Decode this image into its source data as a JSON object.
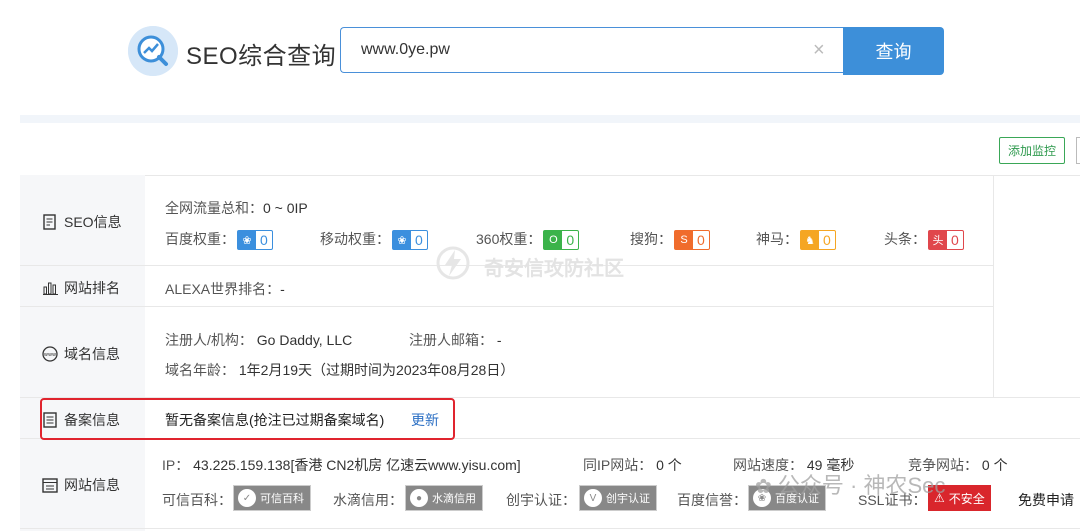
{
  "header": {
    "title": "SEO综合查询",
    "search_value": "www.0ye.pw",
    "clear_glyph": "×",
    "search_button": "查询"
  },
  "toolbar": {
    "monitor_button": "添加监控"
  },
  "watermark": "奇安信攻防社区",
  "wx_overlay": "公众号 · 神农Sec",
  "rows": {
    "seo": {
      "label": "SEO信息",
      "traffic_label": "全网流量总和：",
      "traffic_value": "0 ~ 0IP",
      "weights": [
        {
          "label": "百度权重：",
          "value": "0",
          "color": "#3b8fde",
          "icon": "paw-icon",
          "glyph": "❀"
        },
        {
          "label": "移动权重：",
          "value": "0",
          "color": "#3b8fde",
          "icon": "paw-icon",
          "glyph": "❀"
        },
        {
          "label": "360权重：",
          "value": "0",
          "color": "#3bb34a",
          "icon": "360-icon",
          "glyph": "O"
        },
        {
          "label": "搜狗：",
          "value": "0",
          "color": "#f06c2c",
          "icon": "sogou-icon",
          "glyph": "S"
        },
        {
          "label": "神马：",
          "value": "0",
          "color": "#f5a623",
          "icon": "shenma-icon",
          "glyph": "♞"
        },
        {
          "label": "头条：",
          "value": "0",
          "color": "#e0474c",
          "icon": "toutiao-icon",
          "glyph": "头"
        }
      ]
    },
    "rank": {
      "label": "网站排名",
      "alexa_label": "ALEXA世界排名：",
      "alexa_value": "-"
    },
    "domain": {
      "label": "域名信息",
      "registrant_label": "注册人/机构：",
      "registrant_value": "Go Daddy, LLC",
      "email_label": "注册人邮箱：",
      "email_value": "-",
      "age_label": "域名年龄：",
      "age_value": "1年2月19天（过期时间为2023年08月28日）"
    },
    "icp": {
      "label": "备案信息",
      "text": "暂无备案信息(抢注已过期备案域名)",
      "update_link": "更新"
    },
    "site": {
      "label": "网站信息",
      "ip_label": "IP：",
      "ip_value": "43.225.159.138[香港 CN2机房 亿速云www.yisu.com]",
      "same_ip_label": "同IP网站：",
      "same_ip_value": "0 个",
      "speed_label": "网站速度：",
      "speed_value": "49 毫秒",
      "compete_label": "竞争网站：",
      "compete_value": "0 个",
      "credit_label": "可信百科：",
      "credit_badge": "可信百科",
      "water_label": "水滴信用：",
      "water_badge": "水滴信用",
      "chuangyu_label": "创宇认证：",
      "chuangyu_badge": "创宇认证",
      "baidu_label": "百度信誉：",
      "baidu_badge": "百度认证",
      "ssl_label": "SSL证书：",
      "ssl_badge": "不安全",
      "ssl_apply": "免费申请"
    }
  }
}
